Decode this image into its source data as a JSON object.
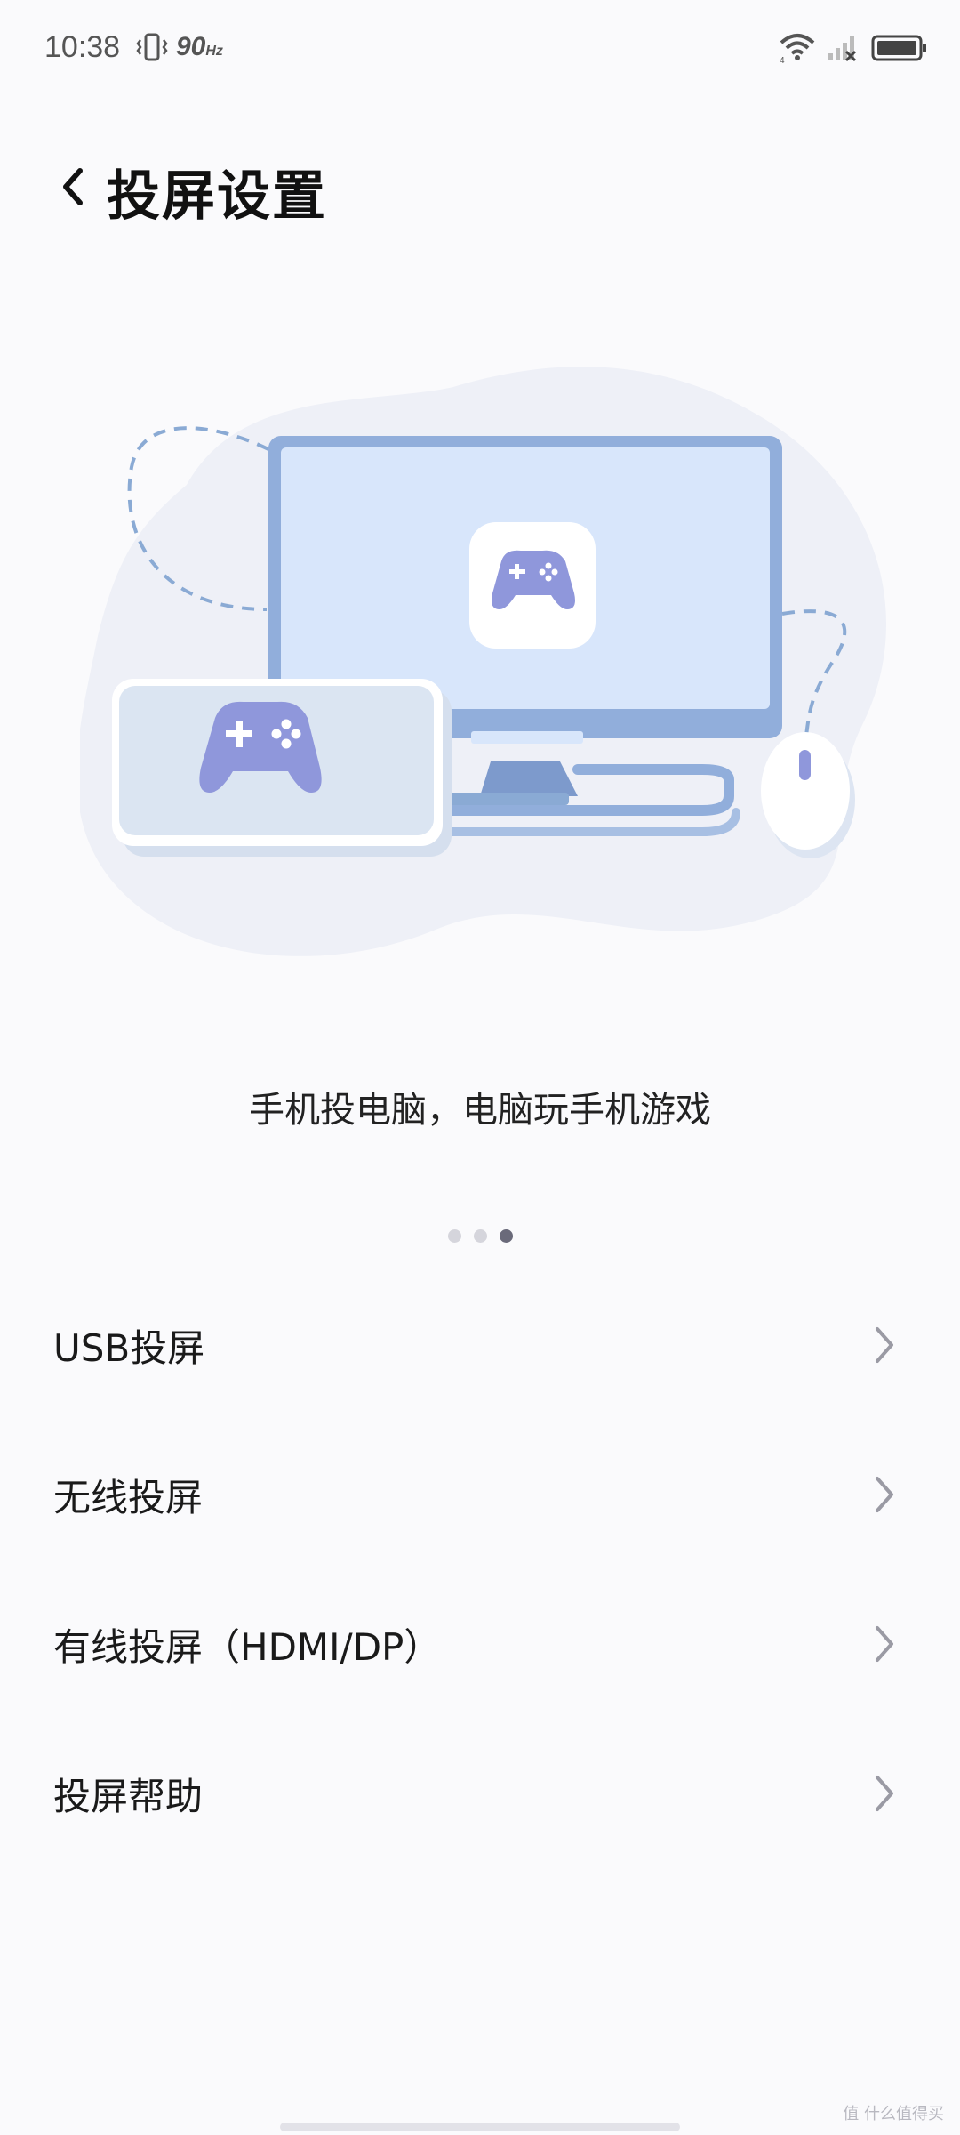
{
  "status_bar": {
    "time": "10:38",
    "refresh_rate": "90",
    "refresh_unit": "Hz",
    "icons": [
      "vibrate-icon",
      "wifi-icon",
      "signal-icon",
      "battery-icon"
    ]
  },
  "header": {
    "back_icon": "chevron-left-icon",
    "title": "投屏设置"
  },
  "illustration": {
    "icons": [
      "monitor-icon",
      "gamepad-icon",
      "mouse-icon",
      "phone-icon"
    ],
    "colors": {
      "blob": "#eef0f7",
      "monitor_frame": "#91aedb",
      "monitor_screen": "#d8e6fb",
      "gamepad": "#8f97db",
      "dashed_cable": "#8aaad4"
    }
  },
  "carousel": {
    "caption": "手机投电脑，电脑玩手机游戏",
    "page_count": 3,
    "active_page": 3
  },
  "menu": {
    "items": [
      {
        "label": "USB投屏"
      },
      {
        "label": "无线投屏"
      },
      {
        "label": "有线投屏（HDMI/DP）"
      },
      {
        "label": "投屏帮助"
      }
    ]
  },
  "watermark": "值 什么值得买"
}
